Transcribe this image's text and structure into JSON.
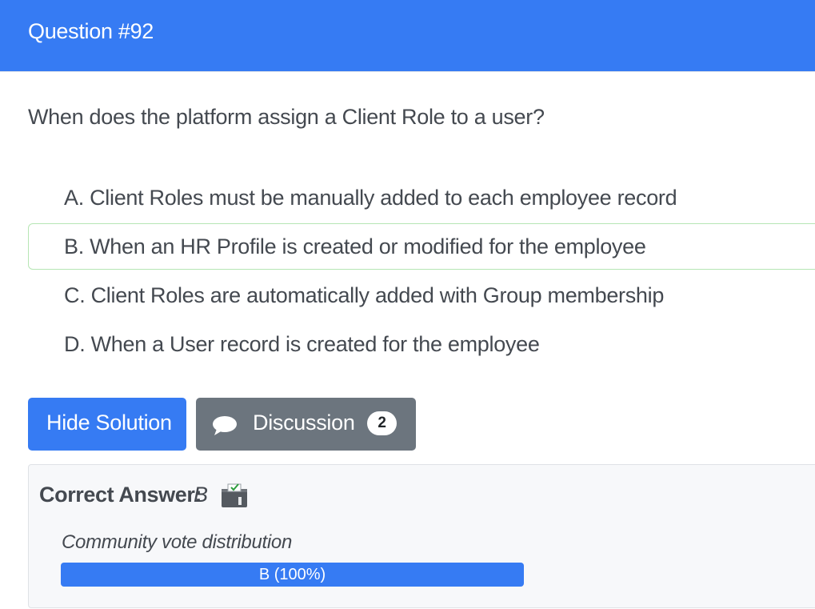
{
  "header": {
    "title": "Question #92",
    "color": "#367bf3"
  },
  "question": {
    "text": "When does the platform assign a Client Role to a user?"
  },
  "choices": [
    {
      "text": "A. Client Roles must be manually added to each employee record",
      "correct": false
    },
    {
      "text": "B. When an HR Profile is created or modified for the employee",
      "correct": true
    },
    {
      "text": "C. Client Roles are automatically added with Group membership",
      "correct": false
    },
    {
      "text": "D. When a User record is created for the employee",
      "correct": false
    }
  ],
  "buttons": {
    "hide_solution": "Hide Solution",
    "discussion": "Discussion",
    "discussion_count": "2",
    "discussion_icon": "chat-bubble-icon"
  },
  "answer": {
    "label": "Correct Answer:",
    "value": "B",
    "icon": "ballot-box-icon"
  },
  "votes": {
    "label": "Community vote distribution",
    "bars": [
      {
        "text": "B (100%)",
        "fraction": 1.0,
        "color": "#367bf3"
      }
    ]
  }
}
